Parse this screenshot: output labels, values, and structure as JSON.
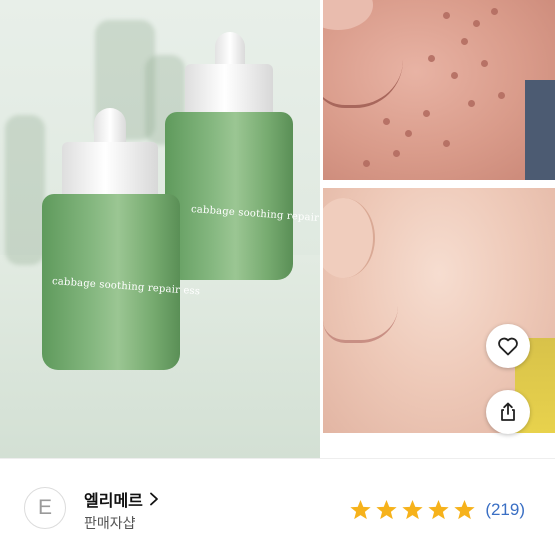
{
  "product": {
    "label_front": "cabbage soothing  repair ess",
    "label_back": "cabbage soothing  repair"
  },
  "actions": {
    "like_icon": "heart-outline-icon",
    "share_icon": "share-icon"
  },
  "seller": {
    "avatar_letter": "E",
    "name": "엘리메르",
    "subtitle": "판매자샵",
    "chevron_icon": "chevron-right-icon",
    "rating": {
      "stars": 5,
      "star_color": "#F6B21B",
      "review_count": "(219)",
      "count_color": "#3A6FC4"
    }
  }
}
